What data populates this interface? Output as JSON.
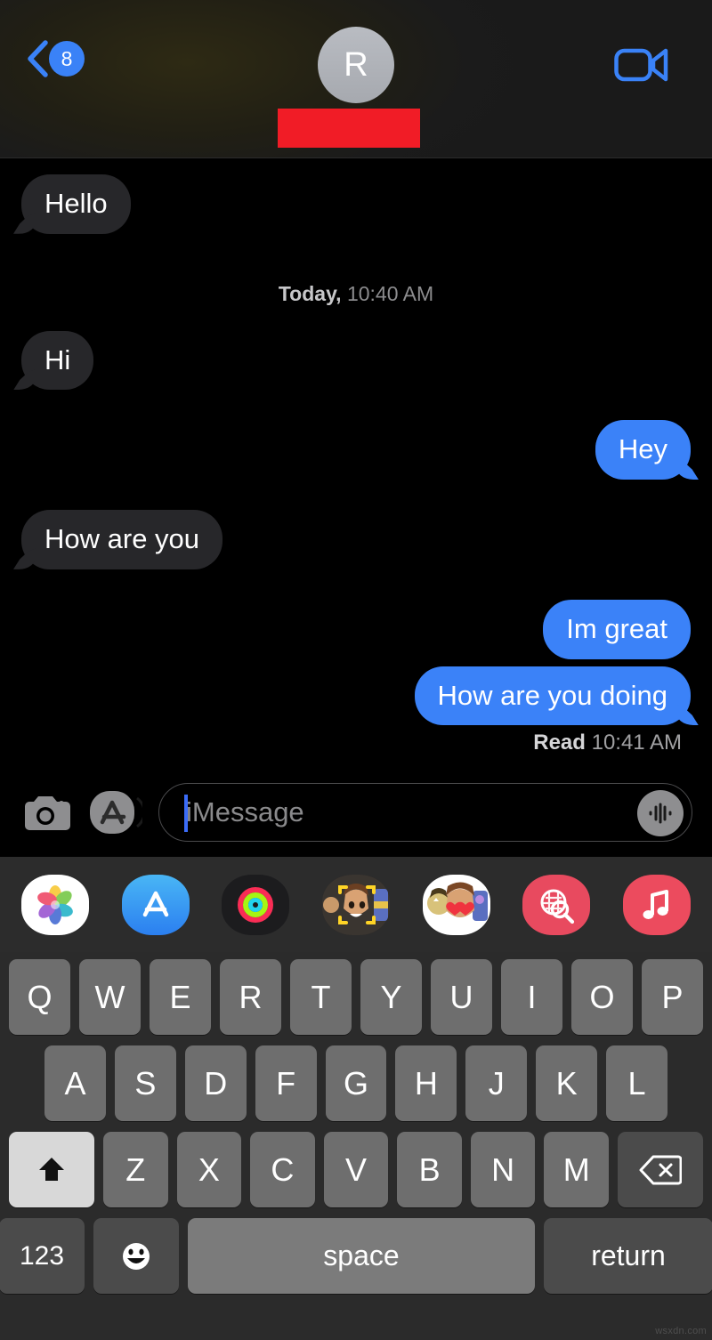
{
  "header": {
    "back_badge_count": "8",
    "back_icon": "chevron-left-icon",
    "avatar_initial": "R",
    "contact_name_redacted": "",
    "video_icon": "video-camera-icon",
    "redaction_color": "#f11c26",
    "accent_color": "#3a82f7"
  },
  "conversation": {
    "messages": [
      {
        "id": 0,
        "text": "Hello",
        "side": "in",
        "tail": true
      },
      {
        "id": 1,
        "type": "timestamp",
        "label": "Today,",
        "time": "10:40 AM"
      },
      {
        "id": 2,
        "text": "Hi",
        "side": "in",
        "tail": true
      },
      {
        "id": 3,
        "text": "Hey",
        "side": "out",
        "tail": true
      },
      {
        "id": 4,
        "text": "How are you",
        "side": "in",
        "tail": true
      },
      {
        "id": 5,
        "text": "Im great",
        "side": "out",
        "tail": false
      },
      {
        "id": 6,
        "text": "How are you doing",
        "side": "out",
        "tail": true
      }
    ],
    "receipt": {
      "label": "Read",
      "time": "10:41 AM"
    },
    "incoming_bubble_color": "#27272a",
    "outgoing_bubble_color": "#3b82f8"
  },
  "input_bar": {
    "camera_icon": "camera-icon",
    "appstore_icon": "app-store-icon",
    "placeholder": "iMessage",
    "value": "",
    "audio_icon": "audio-waveform-icon",
    "caret_color": "#3b6cf8"
  },
  "app_drawer": {
    "apps": [
      {
        "name": "photos-app",
        "label": "Photos"
      },
      {
        "name": "app-store-app",
        "label": "App Store"
      },
      {
        "name": "fitness-app",
        "label": "Fitness"
      },
      {
        "name": "memoji-app",
        "label": "Memoji"
      },
      {
        "name": "memoji-stickers-app",
        "label": "Memoji Stickers"
      },
      {
        "name": "images-search-app",
        "label": "#images"
      },
      {
        "name": "apple-music-app",
        "label": "Music"
      }
    ]
  },
  "keyboard": {
    "row1": [
      "Q",
      "W",
      "E",
      "R",
      "T",
      "Y",
      "U",
      "I",
      "O",
      "P"
    ],
    "row2": [
      "A",
      "S",
      "D",
      "F",
      "G",
      "H",
      "J",
      "K",
      "L"
    ],
    "row3": [
      "Z",
      "X",
      "C",
      "V",
      "B",
      "N",
      "M"
    ],
    "shift_icon": "shift-arrow-icon",
    "shift_active": true,
    "backspace_icon": "backspace-icon",
    "numbers_label": "123",
    "emoji_icon": "emoji-smiley-icon",
    "space_label": "space",
    "return_label": "return"
  },
  "watermark": "wsxdn.com"
}
